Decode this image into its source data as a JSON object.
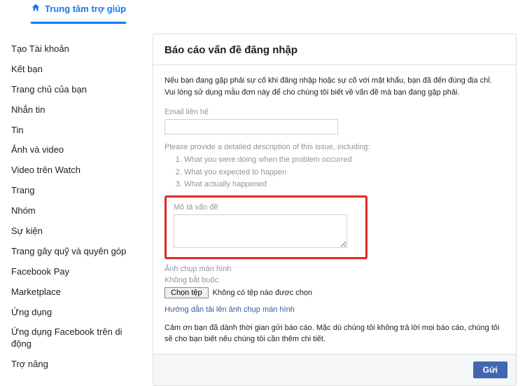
{
  "header": {
    "tab_label": "Trung tâm trợ giúp"
  },
  "sidebar": {
    "items": [
      {
        "label": "Tạo Tài khoản"
      },
      {
        "label": "Kết bạn"
      },
      {
        "label": "Trang chủ của bạn"
      },
      {
        "label": "Nhắn tin"
      },
      {
        "label": "Tin"
      },
      {
        "label": "Ảnh và video"
      },
      {
        "label": "Video trên Watch"
      },
      {
        "label": "Trang"
      },
      {
        "label": "Nhóm"
      },
      {
        "label": "Sự kiện"
      },
      {
        "label": "Trang gây quỹ và quyên góp"
      },
      {
        "label": "Facebook Pay"
      },
      {
        "label": "Marketplace"
      },
      {
        "label": "Ứng dụng"
      },
      {
        "label": "Ứng dụng Facebook trên di động"
      },
      {
        "label": "Trợ năng"
      }
    ]
  },
  "main": {
    "title": "Báo cáo vấn đề đăng nhập",
    "intro": "Nếu bạn đang gặp phải sự cố khi đăng nhập hoặc sự cố với mật khẩu, bạn đã đến đúng địa chỉ. Vui lòng sử dụng mẫu đơn này để cho chúng tôi biết về vấn đề mà bạn đang gặp phải.",
    "email_label": "Email liên hệ",
    "email_value": "",
    "hint_intro": "Please provide a detailed description of this issue, including:",
    "hint_items": [
      "What you were doing when the problem occurred",
      "What you expected to happen",
      "What actually happened"
    ],
    "issue_label": "Mô tả vấn đề",
    "issue_value": "",
    "screenshot_label": "Ảnh chụp màn hình",
    "optional_label": "Không bắt buộc",
    "file_button": "Chọn tệp",
    "no_file_text": "Không có tệp nào được chọn",
    "upload_guide_link": "Hướng dẫn tải lên ảnh chụp màn hình",
    "thanks": "Cảm ơn bạn đã dành thời gian gửi báo cáo. Mặc dù chúng tôi không trả lời mọi báo cáo, chúng tôi sẽ cho bạn biết nếu chúng tôi cần thêm chi tiết.",
    "submit_label": "Gửi"
  }
}
